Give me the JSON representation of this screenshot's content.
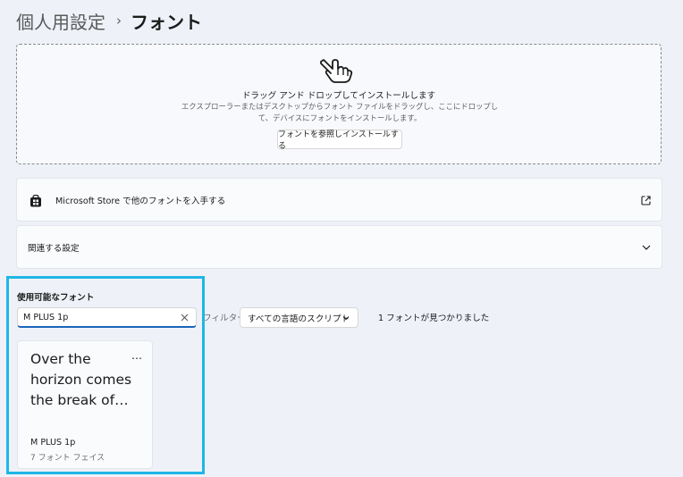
{
  "breadcrumb": {
    "parent": "個人用設定",
    "separator": "›",
    "current": "フォント"
  },
  "drop_zone": {
    "icon": "hand-pointer-icon",
    "title": "ドラッグ アンド ドロップしてインストールします",
    "description": "エクスプローラーまたはデスクトップからフォント ファイルをドラッグし、ここにドロップして、デバイスにフォントをインストールします。",
    "browse_button": "フォントを参照しインストールする"
  },
  "store_card": {
    "icon": "store-icon",
    "label": "Microsoft Store で他のフォントを入手する",
    "action_icon": "external-link-icon"
  },
  "related_card": {
    "label": "関連する設定",
    "action_icon": "chevron-down-icon"
  },
  "available_fonts": {
    "title": "使用可能なフォント",
    "search": {
      "value": "M PLUS 1p",
      "clear_icon": "close-icon"
    },
    "filter_label": "フィルター:",
    "filter_value": "すべての言語のスクリプト",
    "result_count": "1 フォントが見つかりました",
    "fonts": [
      {
        "preview": "Over the horizon comes the break of…",
        "name": "M PLUS 1p",
        "faces": "7 フォント フェイス",
        "more": "…"
      }
    ]
  },
  "colors": {
    "highlight": "#1fb6e6",
    "accent": "#1a65b8",
    "background": "#eef2f8"
  }
}
